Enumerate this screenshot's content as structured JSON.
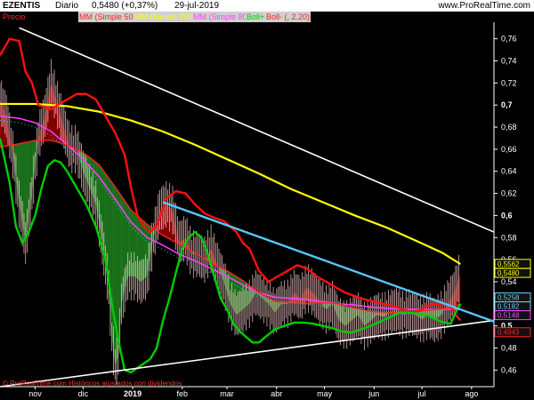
{
  "header": {
    "symbol": "EZENTIS",
    "period": "Diario",
    "last": "0,5480 (+0,37%)",
    "date": "29-jul-2019",
    "site": "www.ProRealTime.com"
  },
  "legend": [
    {
      "label": "Precio",
      "color": "#ff2a2a",
      "bg": "#000000"
    },
    {
      "label": "MM (Simple 50)",
      "color": "#ff2020",
      "bg": "#d0d0d0"
    },
    {
      "label": "MM (Simple 200)",
      "color": "#ffff00",
      "bg": "#d0d0d0"
    },
    {
      "label": "MM (Simple 80)",
      "color": "#ff40ff",
      "bg": "#d0d0d0"
    },
    {
      "label": "Boll+",
      "color": "#00cc00",
      "bg": "#d0d0d0"
    },
    {
      "label": "Boll- (, 2.20)",
      "color": "#ff2020",
      "bg": "#d0d0d0"
    }
  ],
  "footnote": "© ProRealTime.com  Históricos ajustados con dividendos",
  "chart_data": {
    "type": "line",
    "ylim": [
      0.445,
      0.775
    ],
    "y_ticks": [
      0.46,
      0.48,
      0.5,
      0.52,
      0.54,
      0.56,
      0.58,
      0.6,
      0.62,
      0.64,
      0.66,
      0.68,
      0.7,
      0.72,
      0.74,
      0.76
    ],
    "y_tick_labels": [
      "0,46",
      "0,48",
      "0,5",
      "0,52",
      "0,54",
      "0,56",
      "0,58",
      "0,6",
      "0,62",
      "0,64",
      "0,66",
      "0,68",
      "0,7",
      "0,72",
      "0,74",
      "0,76"
    ],
    "major_ticks": [
      "0,5",
      "0,6",
      "0,7"
    ],
    "x_labels": [
      "nov",
      "dic",
      "2019",
      "feb",
      "mar",
      "abr",
      "may",
      "jun",
      "jul",
      "ago"
    ],
    "x_label_days": [
      0,
      30,
      61,
      92,
      120,
      151,
      181,
      212,
      242,
      273
    ],
    "x_start_day": -22,
    "x_end_day": 287,
    "value_labels": [
      {
        "text": "0,5562",
        "value": 0.5562,
        "color": "#ffff00"
      },
      {
        "text": "0,5480",
        "value": 0.548,
        "color": "#ffff00"
      },
      {
        "text": "0,5258",
        "value": 0.5258,
        "color": "#70d0ff"
      },
      {
        "text": "0,5182",
        "value": 0.5182,
        "color": "#70d0ff"
      },
      {
        "text": "0,5148",
        "value": 0.5148,
        "color": "#ff40ff"
      },
      {
        "text": "0,4943",
        "value": 0.4943,
        "color": "#ff2020"
      }
    ],
    "series": [
      {
        "kind": "close",
        "color": "#ffc0c0",
        "points": [
          [
            -22,
            0.705
          ],
          [
            -18,
            0.69
          ],
          [
            -14,
            0.655
          ],
          [
            -10,
            0.61
          ],
          [
            -6,
            0.575
          ],
          [
            -2,
            0.62
          ],
          [
            2,
            0.67
          ],
          [
            6,
            0.69
          ],
          [
            10,
            0.72
          ],
          [
            14,
            0.7
          ],
          [
            18,
            0.68
          ],
          [
            22,
            0.66
          ],
          [
            26,
            0.66
          ],
          [
            30,
            0.64
          ],
          [
            34,
            0.625
          ],
          [
            38,
            0.61
          ],
          [
            42,
            0.575
          ],
          [
            46,
            0.535
          ],
          [
            48,
            0.49
          ],
          [
            50,
            0.465
          ],
          [
            52,
            0.472
          ],
          [
            54,
            0.52
          ],
          [
            58,
            0.545
          ],
          [
            62,
            0.545
          ],
          [
            66,
            0.54
          ],
          [
            70,
            0.545
          ],
          [
            74,
            0.58
          ],
          [
            78,
            0.605
          ],
          [
            82,
            0.61
          ],
          [
            86,
            0.605
          ],
          [
            90,
            0.575
          ],
          [
            94,
            0.58
          ],
          [
            98,
            0.565
          ],
          [
            102,
            0.565
          ],
          [
            106,
            0.56
          ],
          [
            110,
            0.57
          ],
          [
            114,
            0.555
          ],
          [
            118,
            0.54
          ],
          [
            122,
            0.52
          ],
          [
            126,
            0.51
          ],
          [
            130,
            0.515
          ],
          [
            134,
            0.52
          ],
          [
            138,
            0.53
          ],
          [
            142,
            0.525
          ],
          [
            146,
            0.52
          ],
          [
            150,
            0.512
          ],
          [
            154,
            0.52
          ],
          [
            158,
            0.52
          ],
          [
            162,
            0.53
          ],
          [
            166,
            0.525
          ],
          [
            170,
            0.535
          ],
          [
            174,
            0.53
          ],
          [
            178,
            0.522
          ],
          [
            182,
            0.515
          ],
          [
            186,
            0.52
          ],
          [
            190,
            0.505
          ],
          [
            194,
            0.5
          ],
          [
            198,
            0.505
          ],
          [
            202,
            0.51
          ],
          [
            206,
            0.5
          ],
          [
            210,
            0.505
          ],
          [
            214,
            0.51
          ],
          [
            218,
            0.508
          ],
          [
            222,
            0.512
          ],
          [
            226,
            0.515
          ],
          [
            230,
            0.51
          ],
          [
            234,
            0.512
          ],
          [
            238,
            0.51
          ],
          [
            242,
            0.506
          ],
          [
            246,
            0.51
          ],
          [
            250,
            0.505
          ],
          [
            254,
            0.51
          ],
          [
            258,
            0.52
          ],
          [
            262,
            0.53
          ],
          [
            266,
            0.547
          ]
        ]
      },
      {
        "kind": "ma200",
        "color": "#ffff00",
        "points": [
          [
            -22,
            0.701
          ],
          [
            0,
            0.701
          ],
          [
            20,
            0.699
          ],
          [
            40,
            0.694
          ],
          [
            60,
            0.686
          ],
          [
            80,
            0.676
          ],
          [
            100,
            0.664
          ],
          [
            120,
            0.651
          ],
          [
            140,
            0.638
          ],
          [
            160,
            0.624
          ],
          [
            180,
            0.612
          ],
          [
            200,
            0.6
          ],
          [
            220,
            0.589
          ],
          [
            240,
            0.576
          ],
          [
            255,
            0.566
          ],
          [
            266,
            0.556
          ]
        ]
      },
      {
        "kind": "ma80",
        "color": "#ff40ff",
        "points": [
          [
            -22,
            0.69
          ],
          [
            -10,
            0.688
          ],
          [
            0,
            0.684
          ],
          [
            10,
            0.676
          ],
          [
            20,
            0.664
          ],
          [
            30,
            0.651
          ],
          [
            40,
            0.635
          ],
          [
            50,
            0.615
          ],
          [
            60,
            0.594
          ],
          [
            70,
            0.58
          ],
          [
            80,
            0.573
          ],
          [
            90,
            0.565
          ],
          [
            100,
            0.559
          ],
          [
            110,
            0.552
          ],
          [
            120,
            0.545
          ],
          [
            130,
            0.537
          ],
          [
            140,
            0.53
          ],
          [
            150,
            0.526
          ],
          [
            160,
            0.525
          ],
          [
            170,
            0.524
          ],
          [
            180,
            0.522
          ],
          [
            190,
            0.52
          ],
          [
            200,
            0.519
          ],
          [
            210,
            0.517
          ],
          [
            220,
            0.516
          ],
          [
            230,
            0.515
          ],
          [
            240,
            0.515
          ],
          [
            250,
            0.515
          ],
          [
            260,
            0.515
          ],
          [
            266,
            0.515
          ]
        ]
      },
      {
        "kind": "ma50",
        "color": "#ff2020",
        "points": [
          [
            -22,
            0.662
          ],
          [
            -10,
            0.665
          ],
          [
            0,
            0.668
          ],
          [
            10,
            0.668
          ],
          [
            20,
            0.664
          ],
          [
            30,
            0.657
          ],
          [
            40,
            0.646
          ],
          [
            50,
            0.626
          ],
          [
            60,
            0.605
          ],
          [
            70,
            0.592
          ],
          [
            80,
            0.582
          ],
          [
            90,
            0.574
          ],
          [
            100,
            0.566
          ],
          [
            110,
            0.557
          ],
          [
            120,
            0.55
          ],
          [
            130,
            0.541
          ],
          [
            140,
            0.53
          ],
          [
            150,
            0.522
          ],
          [
            160,
            0.521
          ],
          [
            170,
            0.52
          ],
          [
            180,
            0.521
          ],
          [
            190,
            0.52
          ],
          [
            200,
            0.516
          ],
          [
            210,
            0.513
          ],
          [
            220,
            0.512
          ],
          [
            230,
            0.512
          ],
          [
            240,
            0.513
          ],
          [
            250,
            0.515
          ],
          [
            260,
            0.516
          ],
          [
            266,
            0.52
          ]
        ]
      },
      {
        "kind": "boll_upper",
        "color": "#ff1010",
        "points": [
          [
            -22,
            0.745
          ],
          [
            -16,
            0.76
          ],
          [
            -10,
            0.758
          ],
          [
            -6,
            0.73
          ],
          [
            -2,
            0.72
          ],
          [
            2,
            0.7
          ],
          [
            6,
            0.698
          ],
          [
            10,
            0.696
          ],
          [
            14,
            0.7
          ],
          [
            20,
            0.705
          ],
          [
            26,
            0.71
          ],
          [
            32,
            0.71
          ],
          [
            38,
            0.705
          ],
          [
            44,
            0.69
          ],
          [
            50,
            0.675
          ],
          [
            56,
            0.655
          ],
          [
            60,
            0.625
          ],
          [
            64,
            0.6
          ],
          [
            68,
            0.59
          ],
          [
            72,
            0.585
          ],
          [
            76,
            0.59
          ],
          [
            82,
            0.615
          ],
          [
            88,
            0.622
          ],
          [
            94,
            0.62
          ],
          [
            100,
            0.61
          ],
          [
            106,
            0.602
          ],
          [
            112,
            0.598
          ],
          [
            118,
            0.595
          ],
          [
            122,
            0.59
          ],
          [
            126,
            0.585
          ],
          [
            130,
            0.575
          ],
          [
            134,
            0.57
          ],
          [
            140,
            0.55
          ],
          [
            146,
            0.54
          ],
          [
            152,
            0.545
          ],
          [
            158,
            0.55
          ],
          [
            164,
            0.555
          ],
          [
            170,
            0.552
          ],
          [
            176,
            0.545
          ],
          [
            182,
            0.54
          ],
          [
            188,
            0.535
          ],
          [
            194,
            0.53
          ],
          [
            200,
            0.527
          ],
          [
            206,
            0.524
          ],
          [
            212,
            0.522
          ],
          [
            218,
            0.52
          ],
          [
            224,
            0.518
          ],
          [
            230,
            0.515
          ],
          [
            236,
            0.512
          ],
          [
            242,
            0.515
          ],
          [
            248,
            0.52
          ],
          [
            254,
            0.52
          ],
          [
            260,
            0.518
          ],
          [
            263,
            0.51
          ],
          [
            266,
            0.505
          ]
        ]
      },
      {
        "kind": "boll_lower",
        "color": "#00cc00",
        "points": [
          [
            -22,
            0.67
          ],
          [
            -16,
            0.63
          ],
          [
            -12,
            0.59
          ],
          [
            -8,
            0.575
          ],
          [
            -4,
            0.585
          ],
          [
            0,
            0.6
          ],
          [
            4,
            0.625
          ],
          [
            8,
            0.645
          ],
          [
            12,
            0.65
          ],
          [
            16,
            0.648
          ],
          [
            20,
            0.64
          ],
          [
            26,
            0.625
          ],
          [
            32,
            0.61
          ],
          [
            38,
            0.59
          ],
          [
            44,
            0.56
          ],
          [
            48,
            0.52
          ],
          [
            52,
            0.487
          ],
          [
            56,
            0.46
          ],
          [
            60,
            0.458
          ],
          [
            64,
            0.462
          ],
          [
            68,
            0.466
          ],
          [
            72,
            0.47
          ],
          [
            76,
            0.48
          ],
          [
            80,
            0.505
          ],
          [
            84,
            0.525
          ],
          [
            88,
            0.548
          ],
          [
            92,
            0.57
          ],
          [
            96,
            0.58
          ],
          [
            100,
            0.585
          ],
          [
            104,
            0.58
          ],
          [
            108,
            0.565
          ],
          [
            112,
            0.545
          ],
          [
            116,
            0.525
          ],
          [
            120,
            0.515
          ],
          [
            124,
            0.502
          ],
          [
            128,
            0.495
          ],
          [
            132,
            0.49
          ],
          [
            136,
            0.485
          ],
          [
            140,
            0.485
          ],
          [
            144,
            0.49
          ],
          [
            150,
            0.497
          ],
          [
            156,
            0.5
          ],
          [
            162,
            0.503
          ],
          [
            168,
            0.503
          ],
          [
            174,
            0.502
          ],
          [
            180,
            0.5
          ],
          [
            186,
            0.498
          ],
          [
            192,
            0.495
          ],
          [
            198,
            0.494
          ],
          [
            204,
            0.497
          ],
          [
            210,
            0.5
          ],
          [
            216,
            0.504
          ],
          [
            222,
            0.508
          ],
          [
            228,
            0.512
          ],
          [
            234,
            0.512
          ],
          [
            240,
            0.511
          ],
          [
            246,
            0.509
          ],
          [
            252,
            0.505
          ],
          [
            256,
            0.503
          ],
          [
            260,
            0.502
          ],
          [
            263,
            0.512
          ],
          [
            266,
            0.52
          ]
        ]
      }
    ],
    "trendlines": [
      {
        "name": "resistance",
        "color": "#ffffff",
        "from": [
          -10,
          0.77
        ],
        "to": [
          287,
          0.585
        ]
      },
      {
        "name": "support",
        "color": "#ffffff",
        "from": [
          -22,
          0.445
        ],
        "to": [
          287,
          0.505
        ]
      },
      {
        "name": "breakout",
        "color": "#55c8ff",
        "from": [
          80,
          0.612
        ],
        "to": [
          287,
          0.504
        ]
      }
    ]
  }
}
